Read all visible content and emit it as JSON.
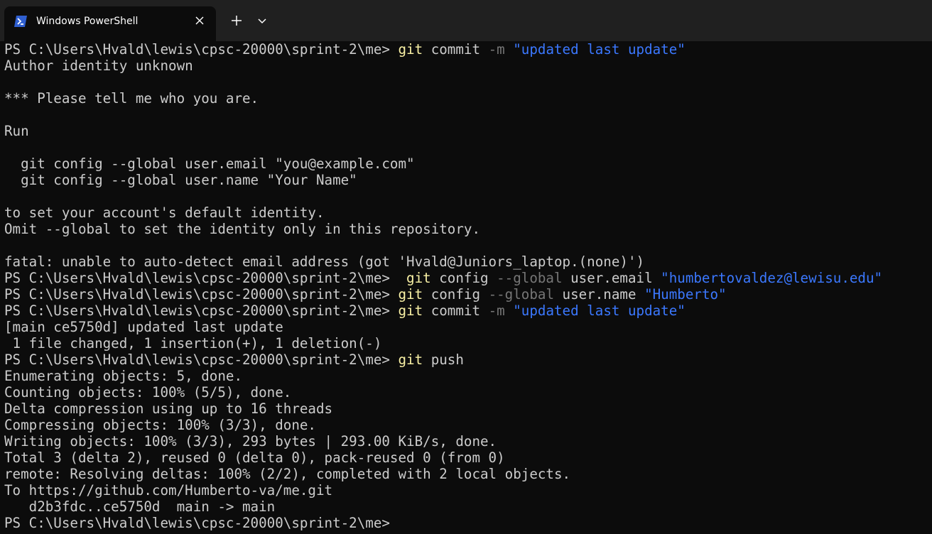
{
  "window": {
    "tab_title": "Windows PowerShell",
    "icons": {
      "tab": "powershell-icon",
      "close": "close-icon",
      "new_tab": "plus-icon",
      "menu": "chevron-down-icon"
    }
  },
  "colors": {
    "background": "#0c0c0c",
    "text": "#cccccc",
    "command": "#f9f1a5",
    "parameter": "#767676",
    "string": "#3b78ff",
    "titlebar": "#202020"
  },
  "terminal": {
    "lines": [
      [
        {
          "t": "PS C:\\Users\\Hvald\\lewis\\cpsc-20000\\sprint-2\\me> "
        },
        {
          "t": "git",
          "c": "cmd"
        },
        {
          "t": " commit "
        },
        {
          "t": "-m",
          "c": "flag"
        },
        {
          "t": " "
        },
        {
          "t": "\"updated last update\"",
          "c": "str"
        }
      ],
      [
        {
          "t": "Author identity unknown"
        }
      ],
      [
        {
          "t": ""
        }
      ],
      [
        {
          "t": "*** Please tell me who you are."
        }
      ],
      [
        {
          "t": ""
        }
      ],
      [
        {
          "t": "Run"
        }
      ],
      [
        {
          "t": ""
        }
      ],
      [
        {
          "t": "  git config --global user.email \"you@example.com\""
        }
      ],
      [
        {
          "t": "  git config --global user.name \"Your Name\""
        }
      ],
      [
        {
          "t": ""
        }
      ],
      [
        {
          "t": "to set your account's default identity."
        }
      ],
      [
        {
          "t": "Omit --global to set the identity only in this repository."
        }
      ],
      [
        {
          "t": ""
        }
      ],
      [
        {
          "t": "fatal: unable to auto-detect email address (got 'Hvald@Juniors_laptop.(none)')"
        }
      ],
      [
        {
          "t": "PS C:\\Users\\Hvald\\lewis\\cpsc-20000\\sprint-2\\me>  "
        },
        {
          "t": "git",
          "c": "cmd"
        },
        {
          "t": " config "
        },
        {
          "t": "--global",
          "c": "flag"
        },
        {
          "t": " user.email "
        },
        {
          "t": "\"humbertovaldez@lewisu.edu\"",
          "c": "str"
        }
      ],
      [
        {
          "t": "PS C:\\Users\\Hvald\\lewis\\cpsc-20000\\sprint-2\\me> "
        },
        {
          "t": "git",
          "c": "cmd"
        },
        {
          "t": " config "
        },
        {
          "t": "--global",
          "c": "flag"
        },
        {
          "t": " user.name "
        },
        {
          "t": "\"Humberto\"",
          "c": "str"
        }
      ],
      [
        {
          "t": "PS C:\\Users\\Hvald\\lewis\\cpsc-20000\\sprint-2\\me> "
        },
        {
          "t": "git",
          "c": "cmd"
        },
        {
          "t": " commit "
        },
        {
          "t": "-m",
          "c": "flag"
        },
        {
          "t": " "
        },
        {
          "t": "\"updated last update\"",
          "c": "str"
        }
      ],
      [
        {
          "t": "[main ce5750d] updated last update"
        }
      ],
      [
        {
          "t": " 1 file changed, 1 insertion(+), 1 deletion(-)"
        }
      ],
      [
        {
          "t": "PS C:\\Users\\Hvald\\lewis\\cpsc-20000\\sprint-2\\me> "
        },
        {
          "t": "git",
          "c": "cmd"
        },
        {
          "t": " push"
        }
      ],
      [
        {
          "t": "Enumerating objects: 5, done."
        }
      ],
      [
        {
          "t": "Counting objects: 100% (5/5), done."
        }
      ],
      [
        {
          "t": "Delta compression using up to 16 threads"
        }
      ],
      [
        {
          "t": "Compressing objects: 100% (3/3), done."
        }
      ],
      [
        {
          "t": "Writing objects: 100% (3/3), 293 bytes | 293.00 KiB/s, done."
        }
      ],
      [
        {
          "t": "Total 3 (delta 2), reused 0 (delta 0), pack-reused 0 (from 0)"
        }
      ],
      [
        {
          "t": "remote: Resolving deltas: 100% (2/2), completed with 2 local objects."
        }
      ],
      [
        {
          "t": "To https://github.com/Humberto-va/me.git"
        }
      ],
      [
        {
          "t": "   d2b3fdc..ce5750d  main -> main"
        }
      ],
      [
        {
          "t": "PS C:\\Users\\Hvald\\lewis\\cpsc-20000\\sprint-2\\me> "
        }
      ]
    ]
  }
}
